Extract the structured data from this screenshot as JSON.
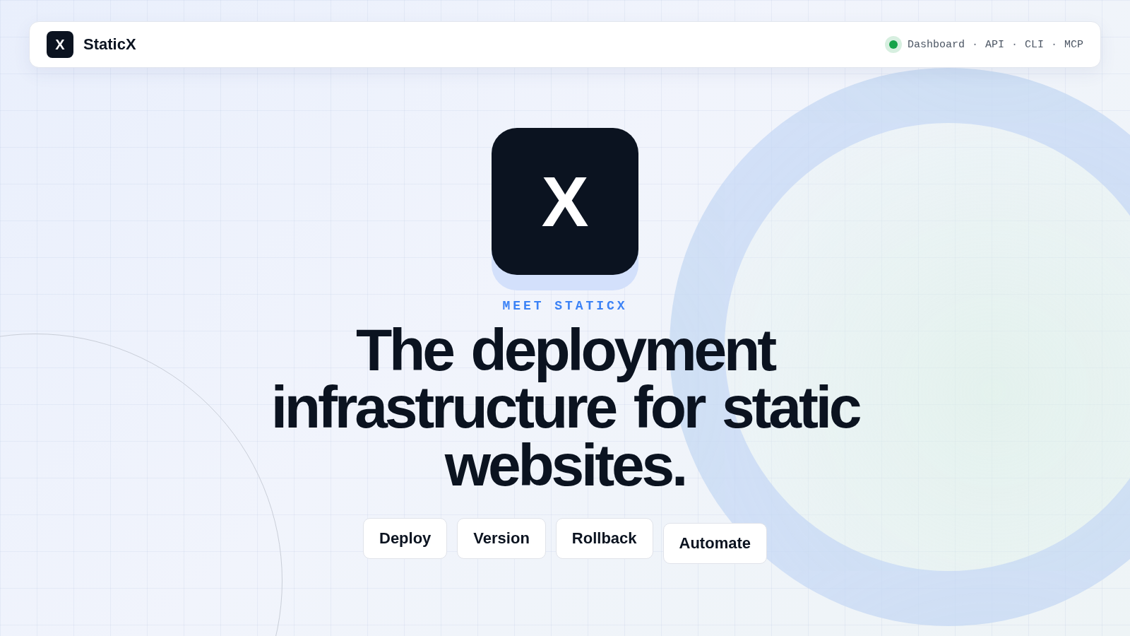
{
  "navbar": {
    "logo_letter": "X",
    "brand": "StaticX",
    "links": [
      {
        "kind": "status"
      },
      {
        "kind": "link",
        "label": "Dashboard"
      },
      {
        "kind": "separator",
        "label": "·"
      },
      {
        "kind": "link",
        "label": "API"
      },
      {
        "kind": "separator",
        "label": "·"
      },
      {
        "kind": "link",
        "label": "CLI"
      },
      {
        "kind": "separator",
        "label": "·"
      },
      {
        "kind": "link",
        "label": "MCP"
      }
    ]
  },
  "hero": {
    "logo_letter": "X",
    "eyebrow": "MEET STATICX",
    "headline": "The deployment infrastructure for static websites.",
    "tags": [
      "Deploy",
      "Version",
      "Rollback",
      "Automate"
    ]
  }
}
